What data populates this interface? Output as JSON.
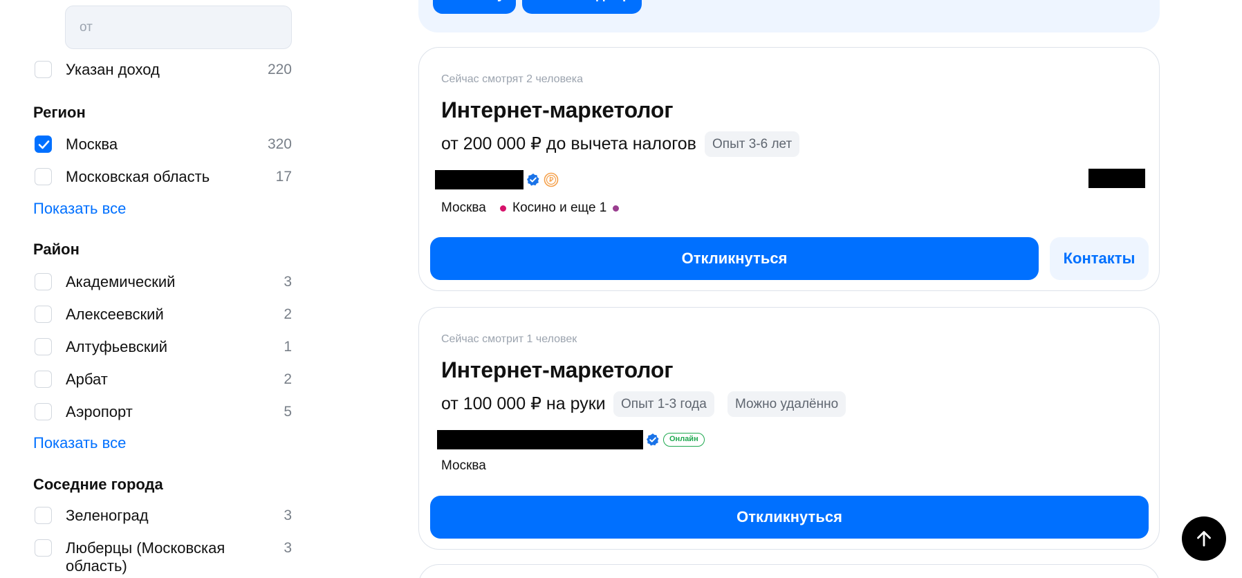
{
  "sidebar": {
    "salary_placeholder": "от",
    "income_filter": {
      "label": "Указан доход",
      "count": "220"
    },
    "region": {
      "title": "Регион",
      "items": [
        {
          "label": "Москва",
          "count": "320",
          "checked": true
        },
        {
          "label": "Московская область",
          "count": "17",
          "checked": false
        }
      ],
      "show_all": "Показать все"
    },
    "district": {
      "title": "Район",
      "items": [
        {
          "label": "Академический",
          "count": "3"
        },
        {
          "label": "Алексеевский",
          "count": "2"
        },
        {
          "label": "Алтуфьевский",
          "count": "1"
        },
        {
          "label": "Арбат",
          "count": "2"
        },
        {
          "label": "Аэропорт",
          "count": "5"
        }
      ],
      "show_all": "Показать все"
    },
    "nearby": {
      "title": "Соседние города",
      "items": [
        {
          "label": "Зеленоград",
          "count": "3"
        },
        {
          "label": "Люберцы (Московская область)",
          "count": "3"
        }
      ]
    }
  },
  "notify": {
    "email_button": "На почту",
    "messenger_button": "В мессенджер"
  },
  "vacancies": [
    {
      "watchers": "Сейчас смотрят 2 человека",
      "title": "Интернет-маркетолог",
      "salary": "от 200 000 ₽ до вычета налогов",
      "tags": [
        "Опыт 3-6 лет"
      ],
      "location_city": "Москва",
      "location_metro": "Косино и еще 1",
      "metro_colors": [
        "#d6116a",
        "#9a3e8f"
      ],
      "respond_button": "Откликнуться",
      "contacts_button": "Контакты"
    },
    {
      "watchers": "Сейчас смотрит 1 человек",
      "title": "Интернет-маркетолог",
      "salary": "от 100 000 ₽ на руки",
      "tags": [
        "Опыт 1-3 года",
        "Можно удалённо"
      ],
      "online_badge": "Онлайн",
      "location_city": "Москва",
      "respond_button": "Откликнуться"
    }
  ],
  "icons": {
    "verified": "verified-check-icon",
    "coin": "coin-icon",
    "scroll_top": "arrow-up-icon",
    "checkbox_check": "checkmark-icon"
  },
  "colors": {
    "accent": "#0070ff",
    "online": "#1ea84f",
    "coin": "#f5a04a"
  }
}
